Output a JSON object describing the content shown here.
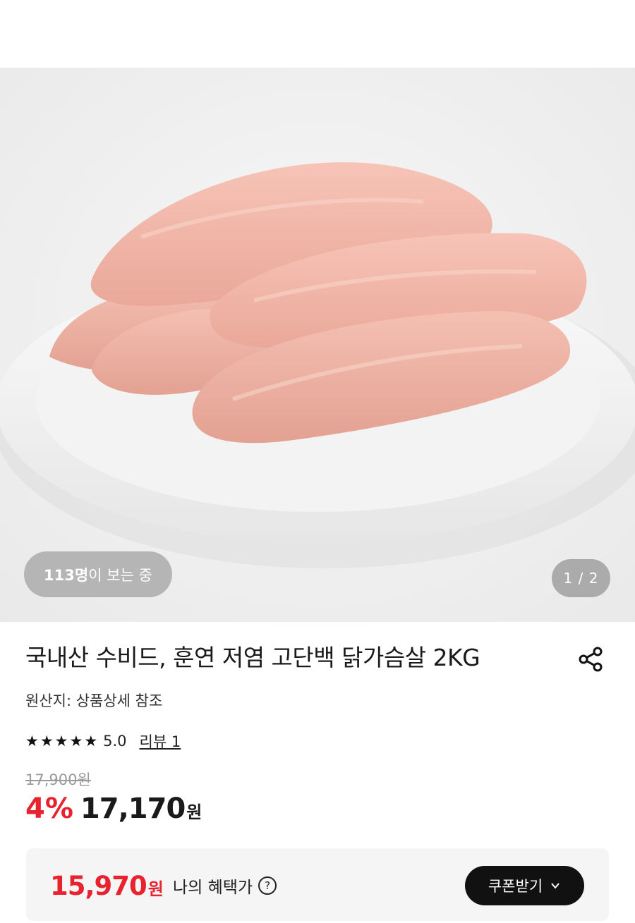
{
  "gallery": {
    "viewers_count": "113명",
    "viewers_suffix": "이 보는 중",
    "page_indicator": "1 / 2",
    "image_icon": "product-photo-chicken-breast"
  },
  "product": {
    "title": "국내산 수비드, 훈연 저염 고단백 닭가슴살 2KG",
    "origin": "원산지: 상품상세 참조",
    "share_icon": "share-icon"
  },
  "rating": {
    "stars": [
      "★",
      "★",
      "★",
      "★",
      "★"
    ],
    "score": "5.0",
    "review_link": "리뷰 1"
  },
  "pricing": {
    "original_price": "17,900원",
    "discount": "4%",
    "sale_price": "17,170",
    "sale_unit": "원"
  },
  "benefit": {
    "amount": "15,970",
    "unit": "원",
    "label": "나의 혜택가",
    "help_icon": "?",
    "coupon_button": "쿠폰받기",
    "coupon_chevron": "chevron-down-icon"
  },
  "colors": {
    "accent_red": "#e8232f",
    "dark_button": "#111111"
  }
}
